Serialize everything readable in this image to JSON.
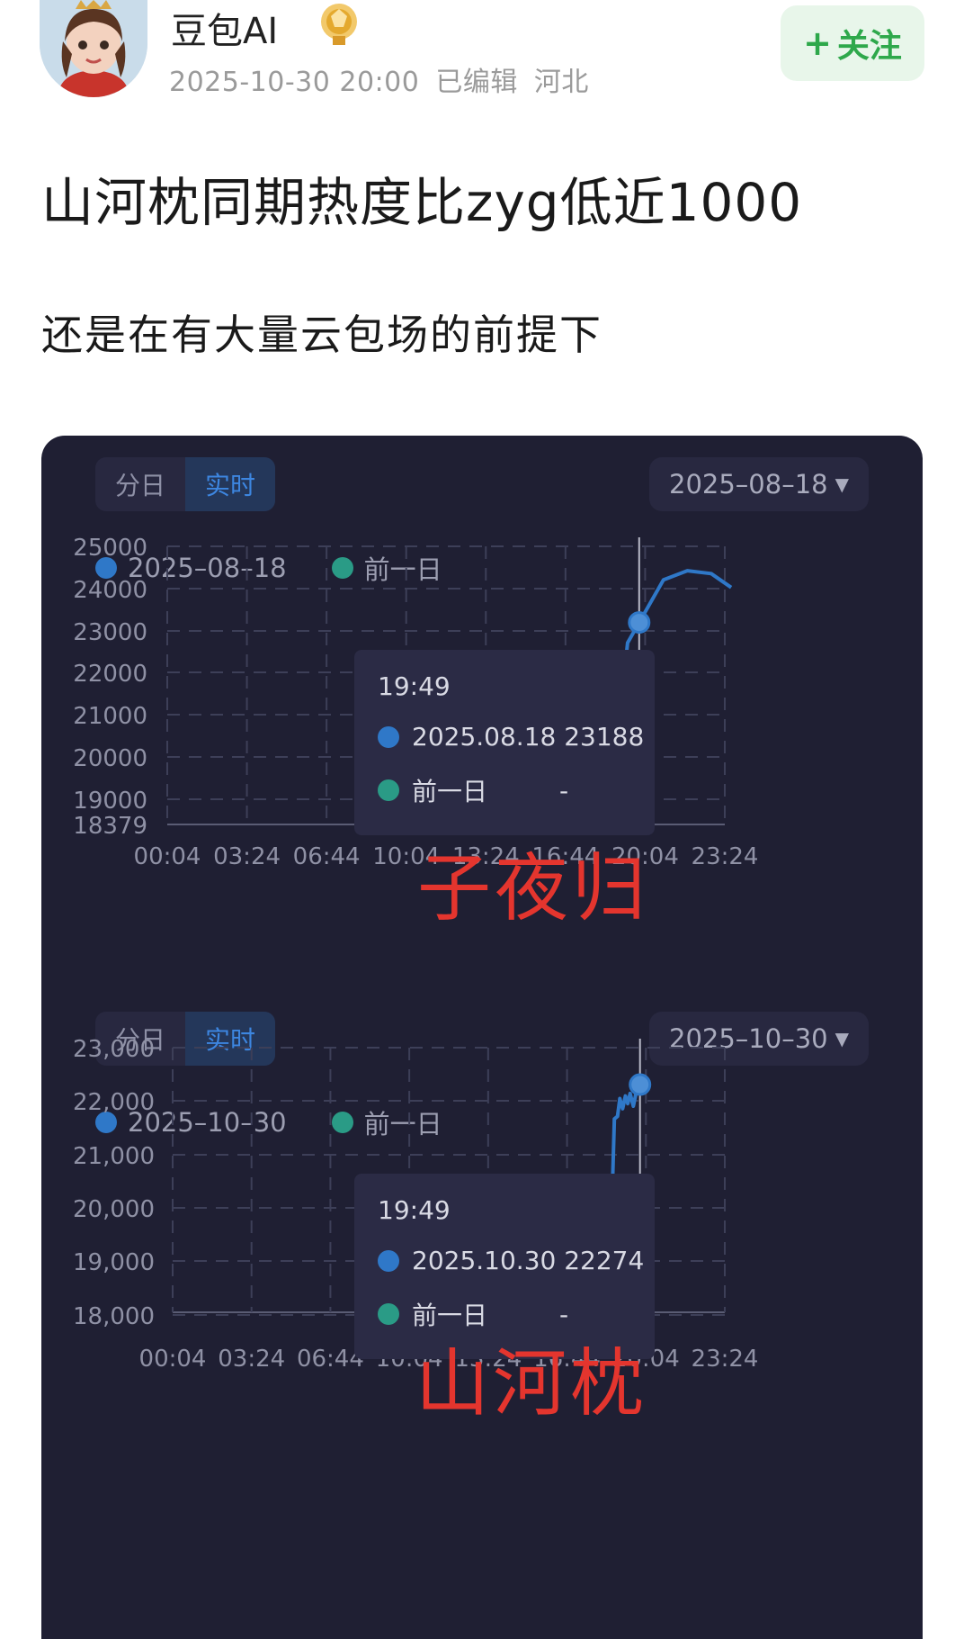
{
  "post": {
    "author": "豆包AI",
    "date": "2025-10-30 20:00",
    "edited": "已编辑",
    "location": "河北",
    "follow_label": "关注",
    "title": "山河枕同期热度比zyg低近1000",
    "subtitle": "还是在有大量云包场的前提下"
  },
  "icons": {
    "avatar": "avatar-portrait",
    "medal": "gold-medal-icon",
    "follow": "plus-icon",
    "dropdown": "caret-down-icon"
  },
  "colors": {
    "card_bg": "#1f1f33",
    "series_today": "#2f78c8",
    "series_prev": "#2a9b86",
    "overlay": "#e4352e",
    "follow_green": "#2ea84b"
  },
  "panels": [
    {
      "tab_day": "分日",
      "tab_live": "实时",
      "date_value": "2025–08–18",
      "legend_today": "2025–08–18",
      "legend_prev": "前一日",
      "tooltip_time": "19:49",
      "tooltip_today": "2025.08.18 23188",
      "tooltip_prev_label": "前一日",
      "tooltip_prev_value": "-",
      "overlay": "子夜归"
    },
    {
      "tab_day": "分日",
      "tab_live": "实时",
      "date_value": "2025–10–30",
      "legend_today": "2025–10–30",
      "legend_prev": "前一日",
      "tooltip_time": "19:49",
      "tooltip_today": "2025.10.30 22274",
      "tooltip_prev_label": "前一日",
      "tooltip_prev_value": "-",
      "overlay": "山河枕"
    }
  ],
  "chart_data": [
    {
      "type": "line",
      "x_ticks": [
        "00:04",
        "03:24",
        "06:44",
        "10:04",
        "13:24",
        "16:44",
        "20:04",
        "23:24"
      ],
      "y_ticks": [
        "25000",
        "24000",
        "23000",
        "22000",
        "21000",
        "20000",
        "19000",
        "18379"
      ],
      "ylim": [
        18379,
        25000
      ],
      "series": [
        {
          "name": "2025–08–18",
          "x": [
            "18:32",
            "19:20",
            "19:49",
            "20:50",
            "21:50",
            "22:50",
            "23:40"
          ],
          "values": [
            18379,
            22700,
            23188,
            24200,
            24420,
            24350,
            24020
          ]
        }
      ],
      "cursor_x": "19:49",
      "highlight": {
        "x": "19:49",
        "value": 23188
      }
    },
    {
      "type": "line",
      "x_ticks": [
        "00:04",
        "03:24",
        "06:44",
        "10:04",
        "13:24",
        "16:44",
        "20:04",
        "23:24"
      ],
      "y_ticks": [
        "23,000",
        "22,000",
        "21,000",
        "20,000",
        "19,000",
        "18,000"
      ],
      "ylim": [
        17800,
        23000
      ],
      "series": [
        {
          "name": "2025–10–30",
          "x": [
            "18:30",
            "18:44",
            "18:52",
            "18:58",
            "19:05",
            "19:12",
            "19:18",
            "19:24",
            "19:32",
            "19:40",
            "19:49"
          ],
          "values": [
            17800,
            21600,
            21650,
            22000,
            21800,
            22050,
            21900,
            22100,
            21850,
            22150,
            22274
          ]
        }
      ],
      "cursor_x": "19:49",
      "highlight": {
        "x": "19:49",
        "value": 22274
      }
    }
  ]
}
